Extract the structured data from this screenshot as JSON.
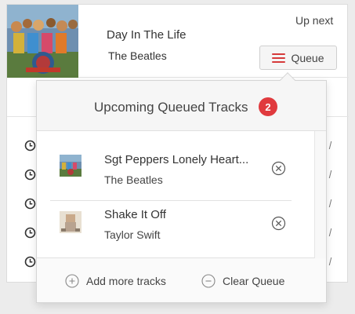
{
  "now_playing": {
    "title": "Day In The Life",
    "artist": "The Beatles",
    "up_next_label": "Up next",
    "queue_button_label": "Queue"
  },
  "queue_popover": {
    "title": "Upcoming Queued Tracks",
    "count": "2",
    "tracks": [
      {
        "title": "Sgt Peppers Lonely Heart...",
        "artist": "The Beatles"
      },
      {
        "title": "Shake It Off",
        "artist": "Taylor Swift"
      }
    ],
    "add_label": "Add more tracks",
    "clear_label": "Clear Queue"
  },
  "icons": {
    "queue": "hamburger-icon",
    "history": "clock-icon",
    "remove": "circle-x-icon",
    "add": "circle-plus-icon",
    "clear": "circle-minus-icon"
  },
  "colors": {
    "accent": "#e03a3e",
    "text": "#333333",
    "border": "#d5d5d5"
  }
}
